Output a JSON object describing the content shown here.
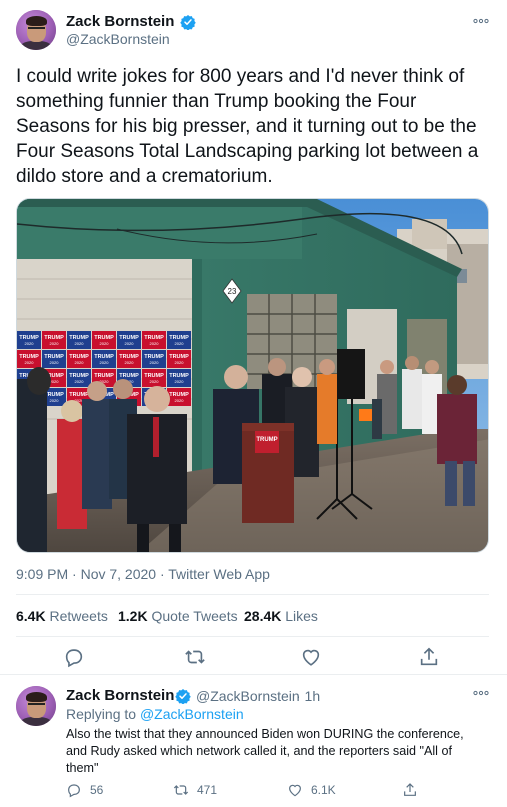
{
  "tweet": {
    "author_name": "Zack Bornstein",
    "handle": "@ZackBornstein",
    "text": "I could write jokes for 800 years and I'd never think of something funnier than Trump booking the Four Seasons for his big presser, and it turning out to be the Four Seasons Total Landscaping parking lot between a dildo store and a crematorium.",
    "timestamp": "9:09 PM · Nov 7, 2020 · Twitter Web App",
    "stats": [
      {
        "value": "6.4K",
        "label": "Retweets"
      },
      {
        "value": "1.2K",
        "label": "Quote Tweets"
      },
      {
        "value": "28.4K",
        "label": "Likes"
      }
    ],
    "photo_signs": {
      "trump": "TRUMP",
      "year": "2020",
      "podium": "TRUMP",
      "address": "23"
    }
  },
  "reply": {
    "author_name": "Zack Bornstein",
    "handle": "@ZackBornstein",
    "time": "· 1h",
    "replying_prefix": "Replying to",
    "replying_to": "@ZackBornstein",
    "text_lines": [
      "Also the twist that they announced Biden won DURING the conference,",
      "and Rudy asked which network called it, and the reporters said \"All of",
      "them\""
    ],
    "reply_count": "56",
    "retweet_count": "471",
    "like_count": "6.1K"
  },
  "icons": {
    "verified": "verified-badge-icon",
    "more": "more-horizontal-icon",
    "reply": "reply-icon",
    "retweet": "retweet-icon",
    "like": "heart-icon",
    "share": "share-icon"
  },
  "colors": {
    "accent": "#1da1f2",
    "secondary_text": "#5b7083",
    "primary_text": "#0f1419",
    "divider": "#ebeef0"
  }
}
